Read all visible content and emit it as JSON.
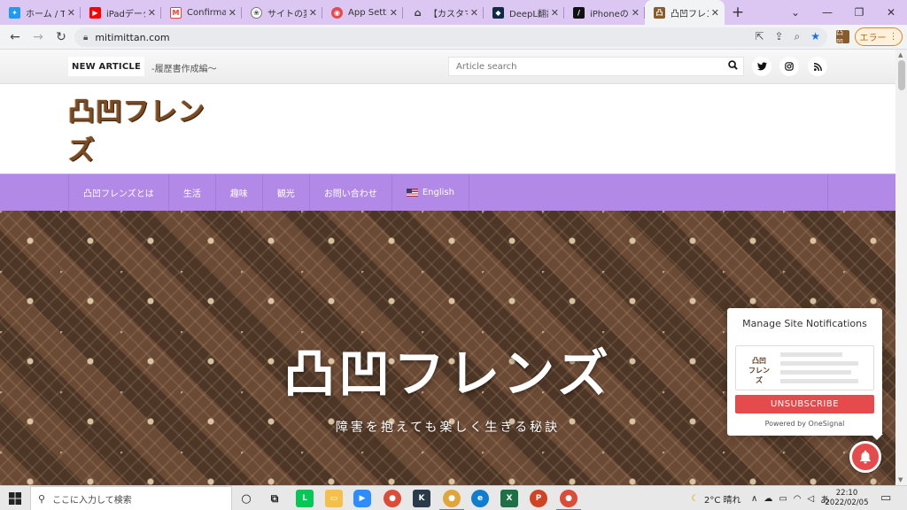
{
  "browser": {
    "tabs": [
      {
        "label": "ホーム / Tw",
        "icon": "twitter-icon",
        "color": "#1d9bf0"
      },
      {
        "label": "iPadデータ",
        "icon": "youtube-icon",
        "color": "#ff0000"
      },
      {
        "label": "Confirma",
        "icon": "gmail-icon",
        "color": "#ea4335"
      },
      {
        "label": "サイトの変",
        "icon": "openai-icon",
        "color": "#6e6e6e"
      },
      {
        "label": "App Settin",
        "icon": "onesignal-icon",
        "color": "#e54b4d"
      },
      {
        "label": "【カスタマイ",
        "icon": "home-icon",
        "color": "#333333"
      },
      {
        "label": "DeepL翻訳",
        "icon": "deepl-icon",
        "color": "#0f2b46"
      },
      {
        "label": "iPhoneの",
        "icon": "notion-icon",
        "color": "#111111"
      },
      {
        "label": "凸凹フレン",
        "icon": "dekoboko-icon",
        "color": "#8a5a2b"
      }
    ],
    "url": "mitimittan.com",
    "error_button": "エラー",
    "extension_label": "凸凹"
  },
  "site": {
    "topbar": {
      "new_article_label": "NEW ARTICLE",
      "new_article_title": "-履歴書作成編～",
      "search_placeholder": "Article search"
    },
    "logo_text": "凸凹フレンズ",
    "nav": [
      "凸凹フレンズとは",
      "生活",
      "趣味",
      "観光",
      "お問い合わせ",
      "English"
    ],
    "hero": {
      "title": "凸凹フレンズ",
      "tagline": "障害を抱えても楽しく生きる秘訣"
    }
  },
  "notification_popup": {
    "title": "Manage Site Notifications",
    "preview_logo": "凸凹\nフレンズ",
    "unsubscribe_label": "UNSUBSCRIBE",
    "powered_by": "Powered by OneSignal"
  },
  "taskbar": {
    "search_placeholder": "ここに入力して検索",
    "weather": "2°C 晴れ",
    "ime": "あ",
    "time": "22:10",
    "date": "2022/02/05"
  },
  "colors": {
    "tab_strip": "#dcc7f2",
    "nav_purple": "#b389e8",
    "onesignal_red": "#e54b4d"
  }
}
